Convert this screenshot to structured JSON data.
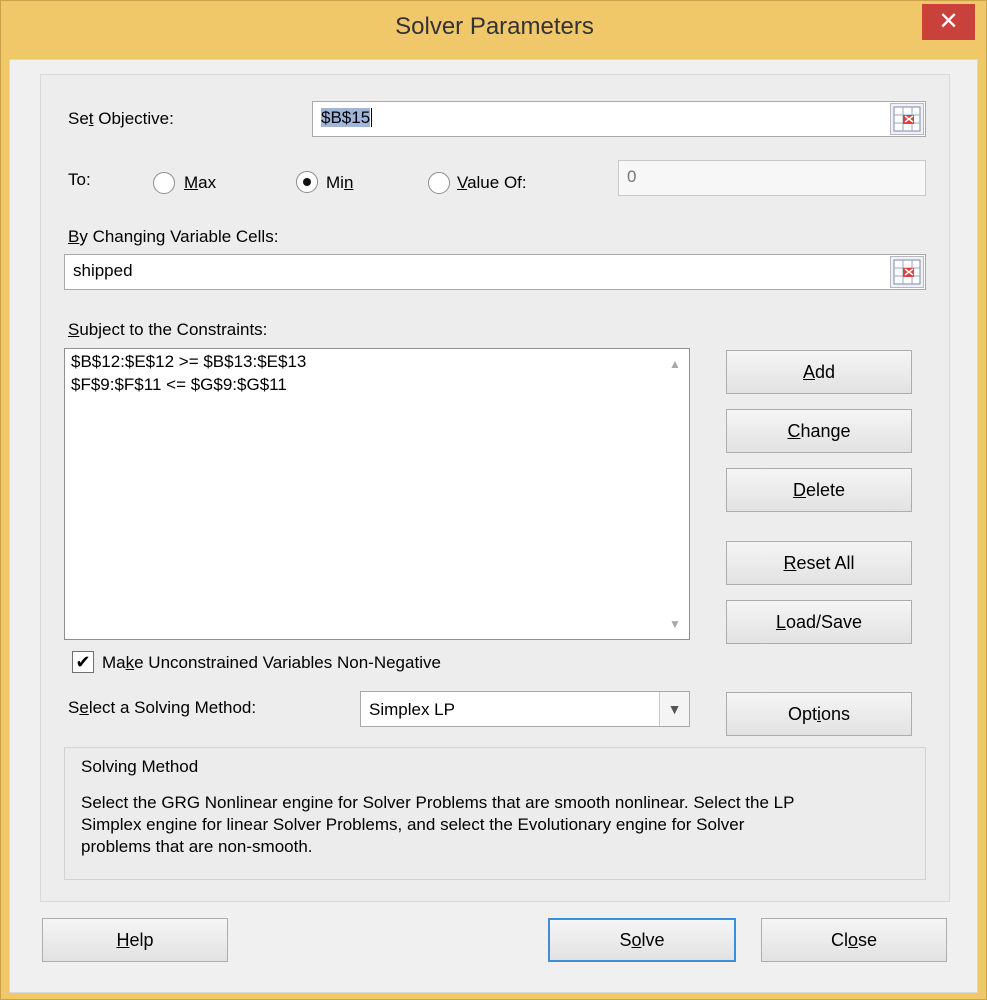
{
  "window": {
    "title": "Solver Parameters",
    "close_glyph": "✕"
  },
  "objective": {
    "label_pre": "Se",
    "label_accel": "t",
    "label_post": " Objective:",
    "value": "$B$15"
  },
  "to": {
    "label": "To:",
    "max": {
      "accel": "M",
      "rest": "ax",
      "selected": false
    },
    "min": {
      "pre": "Mi",
      "accel": "n",
      "selected": true
    },
    "value_of": {
      "accel": "V",
      "rest": "alue Of:",
      "selected": false
    },
    "value_field": "0"
  },
  "variables": {
    "label_accel": "B",
    "label_rest": "y Changing Variable Cells:",
    "value": "shipped"
  },
  "constraints": {
    "label_accel": "S",
    "label_rest": "ubject to the Constraints:",
    "items": [
      "$B$12:$E$12 >= $B$13:$E$13",
      "$F$9:$F$11 <= $G$9:$G$11"
    ]
  },
  "buttons": {
    "add": {
      "accel": "A",
      "rest": "dd"
    },
    "change": {
      "accel": "C",
      "rest": "hange"
    },
    "delete": {
      "accel": "D",
      "rest": "elete"
    },
    "reset_all": {
      "accel": "R",
      "rest": "eset All"
    },
    "load_save": {
      "accel": "L",
      "rest": "oad/Save"
    },
    "options": {
      "pre": "Opt",
      "accel": "i",
      "rest": "ons"
    },
    "help": {
      "accel": "H",
      "rest": "elp"
    },
    "solve": {
      "pre": "S",
      "accel": "o",
      "rest": "lve"
    },
    "close": {
      "pre": "Cl",
      "accel": "o",
      "rest": "se"
    }
  },
  "nonneg": {
    "checked": true,
    "glyph": "✔",
    "pre": "Ma",
    "accel": "k",
    "rest": "e Unconstrained Variables Non-Negative"
  },
  "method": {
    "label_pre": "S",
    "label_accel": "e",
    "label_rest": "lect a Solving Method:",
    "selected": "Simplex LP"
  },
  "description": {
    "heading": "Solving Method",
    "line1": "Select the GRG Nonlinear engine for Solver Problems that are smooth nonlinear. Select the LP",
    "line2": "Simplex engine for linear Solver Problems, and select the Evolutionary engine for Solver",
    "line3": "problems that are non-smooth."
  },
  "icons": {
    "ref": "range-select-icon",
    "scroll_up": "▲",
    "scroll_down": "▼",
    "dropdown": "▼"
  },
  "colors": {
    "title_bar": "#f0c86a",
    "close_button": "#c8413a",
    "default_button_border": "#3c8fd6",
    "client_bg": "#f0f0f0"
  }
}
